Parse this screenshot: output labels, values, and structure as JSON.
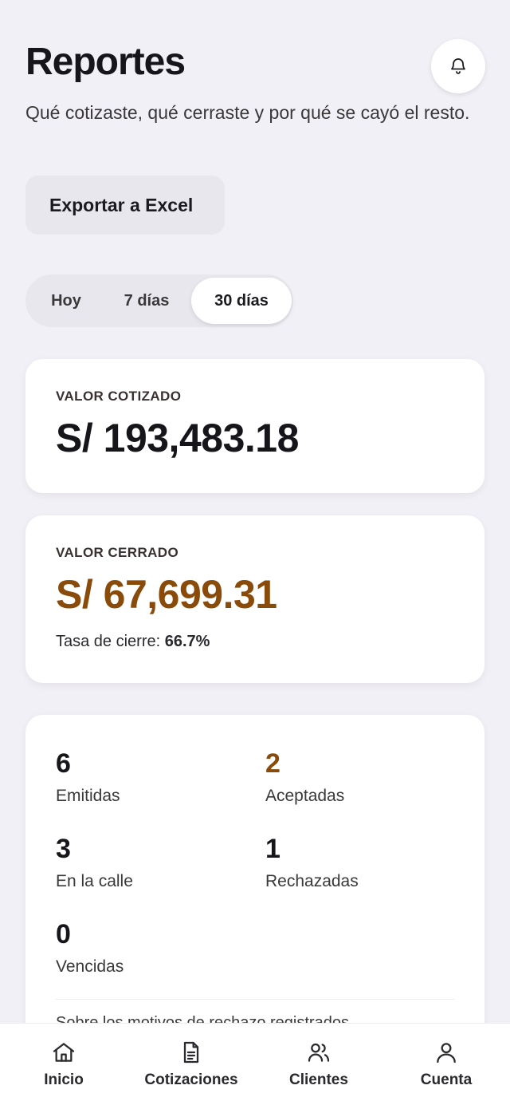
{
  "header": {
    "title": "Reportes",
    "subtitle": "Qué cotizaste, qué cerraste y por qué se cayó el resto."
  },
  "actions": {
    "export_label": "Exportar a Excel"
  },
  "period_tabs": [
    {
      "label": "Hoy",
      "active": false
    },
    {
      "label": "7 días",
      "active": false
    },
    {
      "label": "30 días",
      "active": true
    }
  ],
  "quoted_card": {
    "label": "VALOR COTIZADO",
    "value": "S/ 193,483.18"
  },
  "closed_card": {
    "label": "VALOR CERRADO",
    "value": "S/ 67,699.31",
    "rate_label": "Tasa de cierre:",
    "rate_value": "66.7%"
  },
  "stats": [
    {
      "value": "6",
      "label": "Emitidas"
    },
    {
      "value": "2",
      "label": "Aceptadas"
    },
    {
      "value": "3",
      "label": "En la calle"
    },
    {
      "value": "1",
      "label": "Rechazadas"
    },
    {
      "value": "0",
      "label": "Vencidas"
    }
  ],
  "peek_text": "Sobre los motivos de rechazo registrados",
  "nav": [
    {
      "label": "Inicio",
      "icon": "home-icon"
    },
    {
      "label": "Cotizaciones",
      "icon": "document-icon"
    },
    {
      "label": "Clientes",
      "icon": "users-icon"
    },
    {
      "label": "Cuenta",
      "icon": "user-icon"
    }
  ],
  "colors": {
    "accent": "#8a4b0a",
    "background": "#f1f0f6",
    "card": "#ffffff",
    "text": "#16161a"
  }
}
